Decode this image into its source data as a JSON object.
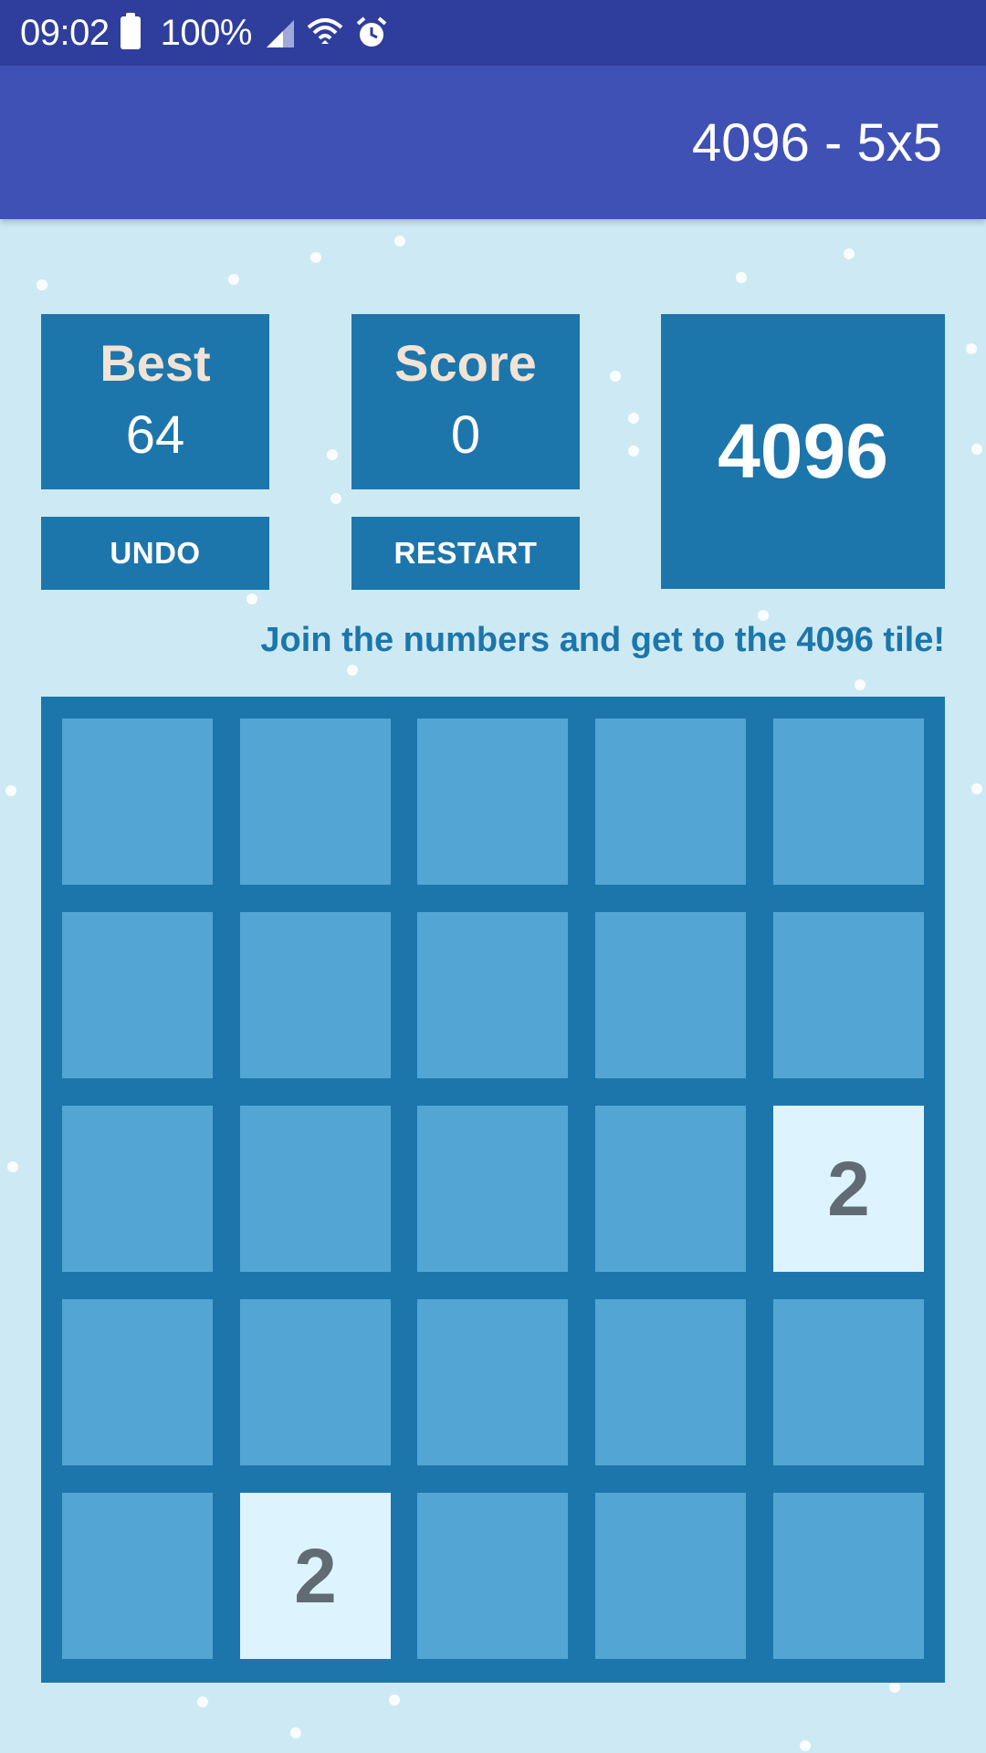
{
  "status_bar": {
    "time": "09:02",
    "battery": "100%",
    "icons": [
      "battery-icon",
      "signal-icon",
      "wifi-icon",
      "alarm-icon"
    ]
  },
  "app_bar": {
    "title": "4096 - 5x5"
  },
  "scores": {
    "best_label": "Best",
    "best_value": "64",
    "score_label": "Score",
    "score_value": "0"
  },
  "buttons": {
    "undo": "UNDO",
    "restart": "RESTART"
  },
  "goal": "4096",
  "tagline": "Join the numbers and get to the 4096 tile!",
  "board": {
    "size": 5,
    "cells": [
      [
        "",
        "",
        "",
        "",
        ""
      ],
      [
        "",
        "",
        "",
        "",
        ""
      ],
      [
        "",
        "",
        "",
        "",
        "2"
      ],
      [
        "",
        "",
        "",
        "",
        ""
      ],
      [
        "",
        "2",
        "",
        "",
        ""
      ]
    ]
  },
  "colors": {
    "status_bar": "#2f3e9d",
    "app_bar": "#3f51b5",
    "background": "#cdeaf4",
    "primary_box": "#1d76ab",
    "empty_cell": "#53a6d3",
    "tile_2": "#ddf4ff"
  }
}
